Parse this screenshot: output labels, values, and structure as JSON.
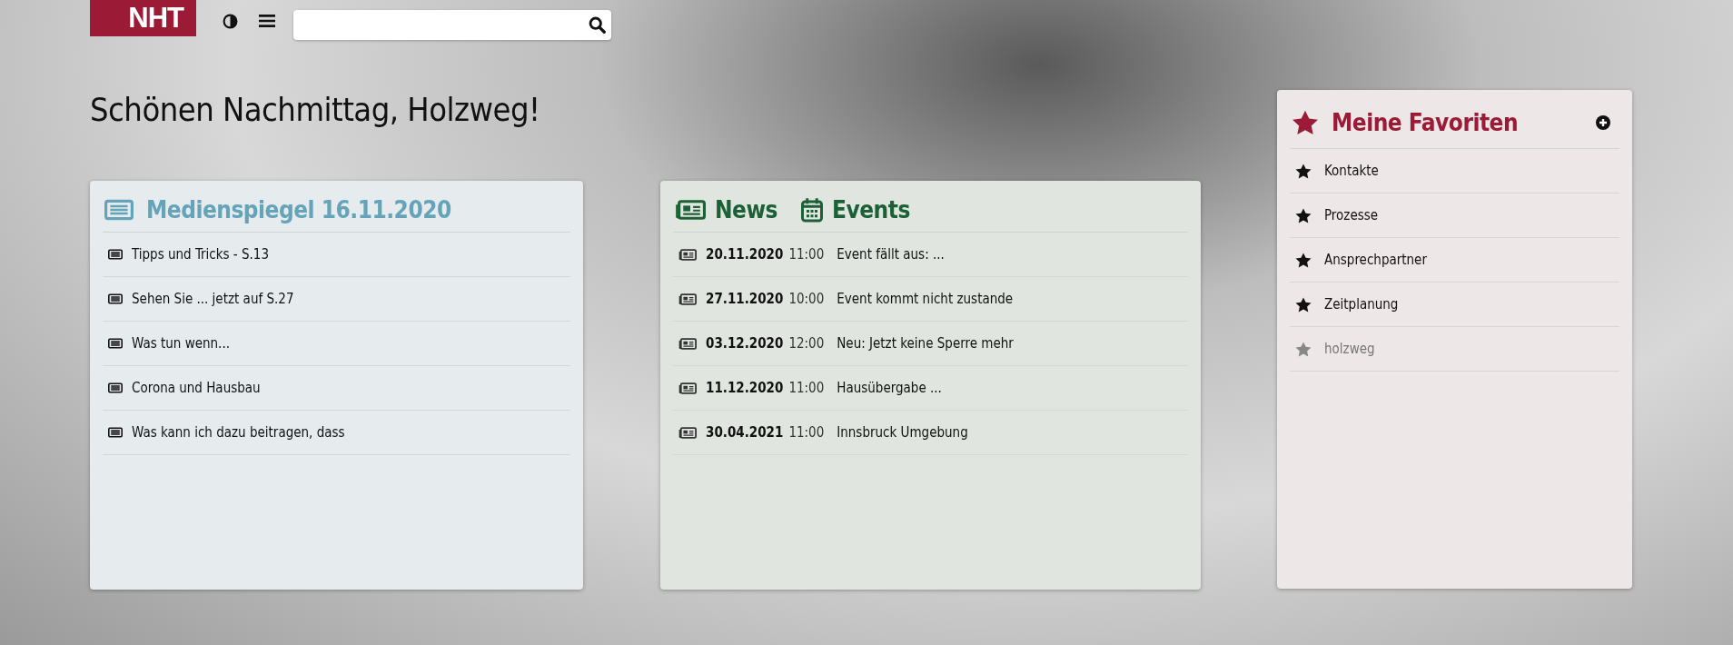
{
  "header": {
    "logo": "NHT"
  },
  "greeting": "Schönen Nachmittag, Holzweg!",
  "medienspiegel": {
    "title": "Medienspiegel 16.11.2020",
    "items": [
      {
        "label": "Tipps und Tricks - S.13"
      },
      {
        "label": "Sehen Sie ... jetzt auf S.27"
      },
      {
        "label": "Was tun wenn..."
      },
      {
        "label": "Corona und Hausbau"
      },
      {
        "label": "Was kann ich dazu beitragen, dass"
      }
    ]
  },
  "news_events": {
    "headings": [
      {
        "kind": "news",
        "label": "News"
      },
      {
        "kind": "events",
        "label": "Events"
      }
    ],
    "items": [
      {
        "date": "20.11.2020",
        "time": "11:00",
        "title": "Event fällt aus: ..."
      },
      {
        "date": "27.11.2020",
        "time": "10:00",
        "title": "Event kommt nicht zustande"
      },
      {
        "date": "03.12.2020",
        "time": "12:00",
        "title": "Neu: Jetzt keine Sperre mehr"
      },
      {
        "date": "11.12.2020",
        "time": "11:00",
        "title": "Hausübergabe ..."
      },
      {
        "date": "30.04.2021",
        "time": "11:00",
        "title": "Innsbruck Umgebung"
      }
    ]
  },
  "favorites": {
    "title": "Meine Favoriten",
    "items": [
      {
        "label": "Kontakte",
        "disabled": false
      },
      {
        "label": "Prozesse",
        "disabled": false
      },
      {
        "label": "Ansprechpartner",
        "disabled": false
      },
      {
        "label": "Zeitplanung",
        "disabled": false
      },
      {
        "label": "holzweg",
        "disabled": true
      }
    ]
  }
}
